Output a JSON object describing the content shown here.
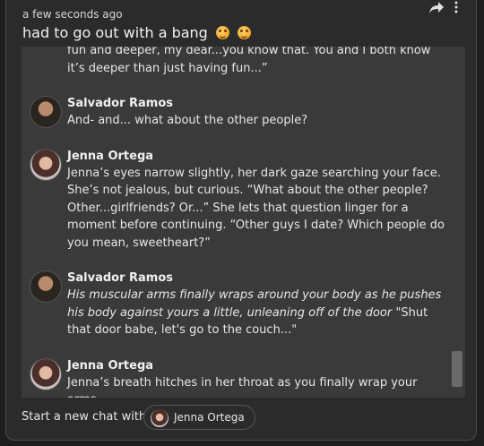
{
  "post": {
    "time": "a few seconds ago",
    "title": "had to go out with a bang"
  },
  "chat": {
    "first_fragment": "fun and deeper, my dear...you know that. You and I both know it’s deeper than just having fun...”",
    "messages": [
      {
        "sender": "Salvador Ramos",
        "text": "And- and... what about the other people?"
      },
      {
        "sender": "Jenna Ortega",
        "text": "Jenna’s eyes narrow slightly, her dark gaze searching your face. She’s not jealous, but curious. “What about the other people? Other...girlfriends? Or...” She lets that question linger for a moment before continuing. “Other guys I date? Which people do you mean, sweetheart?”"
      },
      {
        "sender": "Salvador Ramos",
        "text_italic": "His muscular arms finally wraps around your body as he pushes his body against yours a little, unleaning off of the door",
        "text_rest": " \"Shut that door babe, let's go to the couch...\""
      },
      {
        "sender": "Jenna Ortega",
        "text": "Jenna’s breath hitches in her throat as you finally wrap your arms"
      }
    ]
  },
  "footer": {
    "label": "Start a new chat with",
    "character_name": "Jenna Ortega"
  },
  "icons": {
    "share": "share-arrow-icon",
    "more": "more-vertical-icon"
  }
}
